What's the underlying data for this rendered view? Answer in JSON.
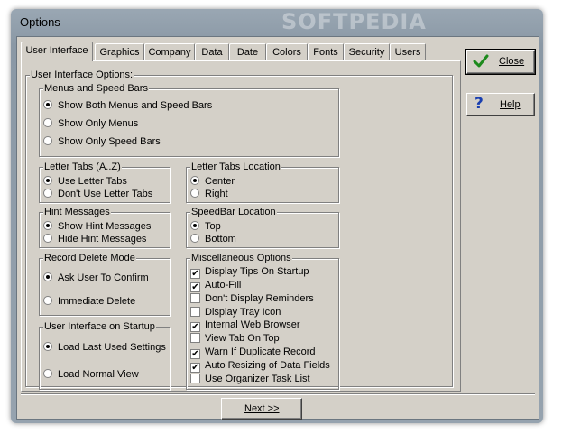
{
  "window": {
    "title": "Options",
    "watermark": "SOFTPEDIA"
  },
  "tabs": [
    "User Interface",
    "Graphics",
    "Company",
    "Data",
    "Date",
    "Colors",
    "Fonts",
    "Security",
    "Users"
  ],
  "active_tab": "User Interface",
  "panel": {
    "label": "User Interface Options:"
  },
  "menus_speedbars": {
    "label": "Menus and Speed Bars",
    "options": [
      "Show Both Menus and Speed Bars",
      "Show Only Menus",
      "Show Only Speed Bars"
    ],
    "selected": "Show Both Menus and Speed Bars"
  },
  "letter_tabs": {
    "label": "Letter Tabs (A..Z)",
    "options": [
      "Use Letter Tabs",
      "Don't Use Letter Tabs"
    ],
    "selected": "Use Letter Tabs"
  },
  "letter_tabs_location": {
    "label": "Letter Tabs Location",
    "options": [
      "Center",
      "Right"
    ],
    "selected": "Center"
  },
  "hint_messages": {
    "label": "Hint Messages",
    "options": [
      "Show Hint Messages",
      "Hide Hint Messages"
    ],
    "selected": "Show Hint Messages"
  },
  "speedbar_location": {
    "label": "SpeedBar Location",
    "options": [
      "Top",
      "Bottom"
    ],
    "selected": "Top"
  },
  "record_delete": {
    "label": "Record Delete Mode",
    "options": [
      "Ask User To Confirm",
      "Immediate Delete"
    ],
    "selected": "Ask User To Confirm"
  },
  "startup": {
    "label": "User Interface on Startup",
    "options": [
      "Load Last Used Settings",
      "Load Normal View"
    ],
    "selected": "Load Last Used Settings"
  },
  "misc": {
    "label": "Miscellaneous Options",
    "items": [
      {
        "label": "Display Tips On Startup",
        "checked": true
      },
      {
        "label": "Auto-Fill",
        "checked": true
      },
      {
        "label": "Don't Display Reminders",
        "checked": false
      },
      {
        "label": "Display Tray Icon",
        "checked": false
      },
      {
        "label": "Internal Web Browser",
        "checked": true
      },
      {
        "label": "View Tab On Top",
        "checked": false
      },
      {
        "label": "Warn If Duplicate Record",
        "checked": true
      },
      {
        "label": "Auto Resizing of Data Fields",
        "checked": true
      },
      {
        "label": "Use Organizer Task List",
        "checked": false
      }
    ]
  },
  "buttons": {
    "close": "Close",
    "help": "Help",
    "next": "Next >>"
  },
  "icons": {
    "close": "green-checkmark-icon",
    "help": "blue-question-mark-icon"
  }
}
